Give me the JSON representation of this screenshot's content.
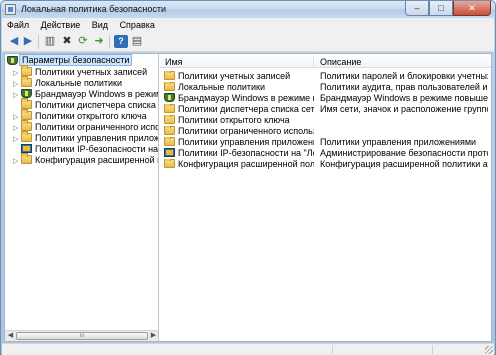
{
  "window": {
    "title": "Локальная политика безопасности",
    "caption_buttons": [
      "–",
      "□",
      "✕"
    ]
  },
  "menu": [
    "Файл",
    "Действие",
    "Вид",
    "Справка"
  ],
  "toolbar": {
    "buttons": [
      "back-icon",
      "forward-icon",
      "console-tree-icon",
      "delete-icon",
      "refresh-icon",
      "export-icon",
      "help-icon",
      "properties-icon"
    ]
  },
  "tree": {
    "root": "Параметры безопасности",
    "items": [
      {
        "label": "Политики учетных записей",
        "icon": "folder-icon"
      },
      {
        "label": "Локальные политики",
        "icon": "folder-icon"
      },
      {
        "label": "Брандмауэр Windows в режиме пов",
        "icon": "shield-icon"
      },
      {
        "label": "Политики диспетчера списка сетей",
        "icon": "folder-icon"
      },
      {
        "label": "Политики открытого ключа",
        "icon": "folder-icon"
      },
      {
        "label": "Политики ограниченного использо",
        "icon": "folder-icon"
      },
      {
        "label": "Политики управления приложения",
        "icon": "folder-icon"
      },
      {
        "label": "Политики IP-безопасности на \"Лока",
        "icon": "ipsec-icon"
      },
      {
        "label": "Конфигурация расширенной полит",
        "icon": "folder-icon"
      }
    ],
    "scroll_label": "ııı"
  },
  "list": {
    "columns": {
      "name": "Имя",
      "description": "Описание"
    },
    "rows": [
      {
        "name": "Политики учетных записей",
        "description": "Политики паролей и блокировки учетных зап",
        "icon": "folder-icon"
      },
      {
        "name": "Локальные политики",
        "description": "Политики аудита, прав пользователей и пар",
        "icon": "folder-icon"
      },
      {
        "name": "Брандмауэр Windows в режиме пов...",
        "description": "Брандмауэр Windows в режиме повышенно...",
        "icon": "shield-icon"
      },
      {
        "name": "Политики диспетчера списка сетей",
        "description": "Имя сети, значок и расположение группов...",
        "icon": "folder-icon"
      },
      {
        "name": "Политики открытого ключа",
        "description": "",
        "icon": "folder-icon"
      },
      {
        "name": "Политики ограниченного использован...",
        "description": "",
        "icon": "folder-icon"
      },
      {
        "name": "Политики управления приложениями",
        "description": "Политики управления приложениями",
        "icon": "folder-icon"
      },
      {
        "name": "Политики IP-безопасности на \"Локаль...",
        "description": "Администрирование безопасности проток...",
        "icon": "ipsec-icon"
      },
      {
        "name": "Конфигурация расширенной политик...",
        "description": "Конфигурация расширенной политики аудита",
        "icon": "folder-icon"
      }
    ]
  }
}
